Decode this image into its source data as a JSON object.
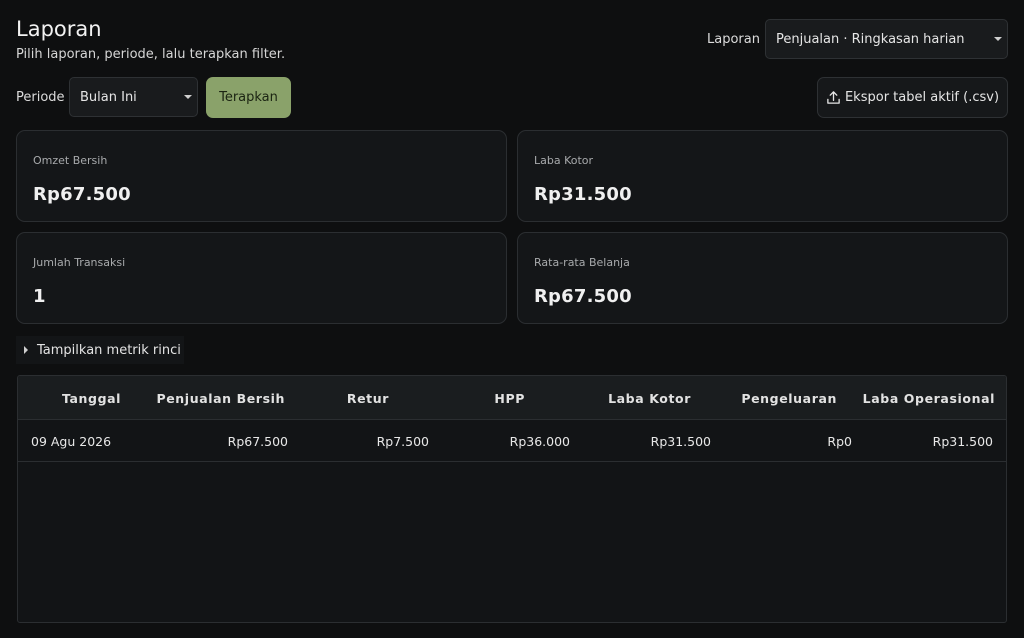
{
  "header": {
    "title": "Laporan",
    "subtitle": "Pilih laporan, periode, lalu terapkan filter."
  },
  "report_select": {
    "label": "Laporan",
    "value": "Penjualan · Ringkasan harian"
  },
  "period": {
    "label": "Periode",
    "value": "Bulan Ini",
    "apply_label": "Terapkan"
  },
  "export": {
    "label": "Ekspor tabel aktif (.csv)",
    "icon": "upload-icon"
  },
  "metrics": [
    {
      "label": "Omzet Bersih",
      "value": "Rp67.500"
    },
    {
      "label": "Laba Kotor",
      "value": "Rp31.500"
    },
    {
      "label": "Jumlah Transaksi",
      "value": "1"
    },
    {
      "label": "Rata-rata Belanja",
      "value": "Rp67.500"
    }
  ],
  "details_toggle": {
    "label": "Tampilkan metrik rinci"
  },
  "table": {
    "columns": [
      "Tanggal",
      "Penjualan Bersih",
      "Retur",
      "HPP",
      "Laba Kotor",
      "Pengeluaran",
      "Laba Operasional"
    ],
    "rows": [
      [
        "09 Agu 2026",
        "Rp67.500",
        "Rp7.500",
        "Rp36.000",
        "Rp31.500",
        "Rp0",
        "Rp31.500"
      ]
    ]
  },
  "colors": {
    "background": "#0e0f10",
    "accent": "#8aa26a"
  }
}
